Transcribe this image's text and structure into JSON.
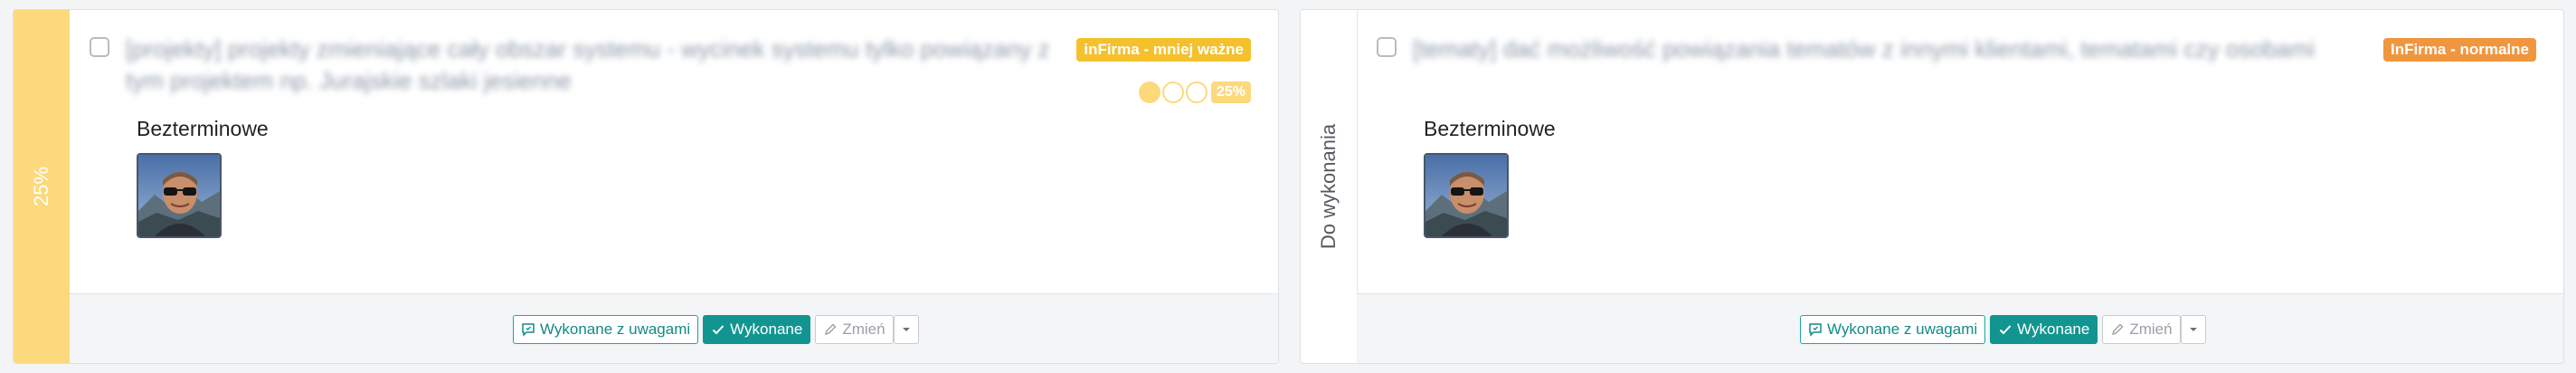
{
  "cards": [
    {
      "side_label": "25%",
      "title": "[projekty] projekty zmieniające cały obszar systemu - wycinek systemu tylko powiązany z tym projektem np. Jurajskie szlaki jesienne",
      "badge": "inFirma - mniej ważne",
      "progress": {
        "completed_dots": 1,
        "total_dots": 3,
        "percent_label": "25%"
      },
      "deadline": "Bezterminowe",
      "buttons": {
        "done_with_notes": "Wykonane z uwagami",
        "done": "Wykonane",
        "change": "Zmień"
      }
    },
    {
      "side_label": "Do wykonania",
      "title": "[tematy] dać możliwość powiązania tematów z innymi klientami, tematami czy osobami",
      "badge": "InFirma - normalne",
      "deadline": "Bezterminowe",
      "buttons": {
        "done_with_notes": "Wykonane z uwagami",
        "done": "Wykonane",
        "change": "Zmień"
      }
    }
  ],
  "colors": {
    "side_yellow": "#fcd97d",
    "badge_low": "#f4c12d",
    "badge_normal": "#f0963e",
    "primary": "#129590"
  }
}
